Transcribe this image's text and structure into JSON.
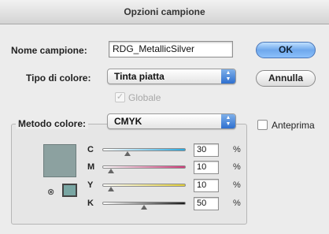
{
  "dialog": {
    "title": "Opzioni campione",
    "name_label": "Nome campione:",
    "name_value": "RDG_MetallicSilver",
    "color_type_label": "Tipo di colore:",
    "color_type_value": "Tinta piatta",
    "global_label": "Globale",
    "color_mode_label": "Metodo colore:",
    "color_mode_value": "CMYK",
    "ok_label": "OK",
    "cancel_label": "Annulla",
    "preview_label": "Anteprima",
    "percent_sign": "%",
    "preview_color": "#8ca1a0",
    "websafe_color": "#79a6a3",
    "accent_color": "#3a7bd5"
  },
  "channels": [
    {
      "letter": "C",
      "value": "30",
      "level": 0.3,
      "gradient": "linear-gradient(90deg,#ffffff,#2aa8df)"
    },
    {
      "letter": "M",
      "value": "10",
      "level": 0.1,
      "gradient": "linear-gradient(90deg,#ffffff,#d13a7a)"
    },
    {
      "letter": "Y",
      "value": "10",
      "level": 0.1,
      "gradient": "linear-gradient(90deg,#ffffff,#e2cf38)"
    },
    {
      "letter": "K",
      "value": "50",
      "level": 0.5,
      "gradient": "linear-gradient(90deg,#ffffff,#1a1a1a)"
    }
  ]
}
